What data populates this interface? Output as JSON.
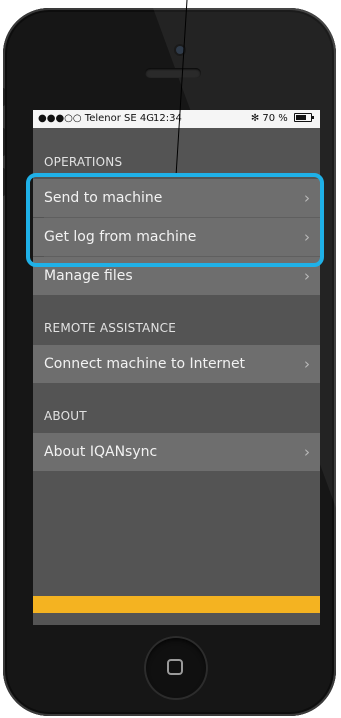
{
  "status_bar": {
    "carrier": "●●●○○ Telenor SE  4G",
    "time": "12:34",
    "battery_text": "✻ 70 %",
    "battery_level": 0.7
  },
  "sections": [
    {
      "header": "OPERATIONS",
      "items": [
        {
          "label": "Send to machine"
        },
        {
          "label": "Get log from machine"
        },
        {
          "label": "Manage files"
        }
      ]
    },
    {
      "header": "REMOTE ASSISTANCE",
      "items": [
        {
          "label": "Connect machine to Internet"
        }
      ]
    },
    {
      "header": "ABOUT",
      "items": [
        {
          "label": "About IQANsync"
        }
      ]
    }
  ],
  "chevron": "›",
  "colors": {
    "highlight": "#1fb1e8",
    "accent_bar": "#f4b321",
    "screen_bg": "#545454",
    "row_bg": "#6e6e6e"
  }
}
